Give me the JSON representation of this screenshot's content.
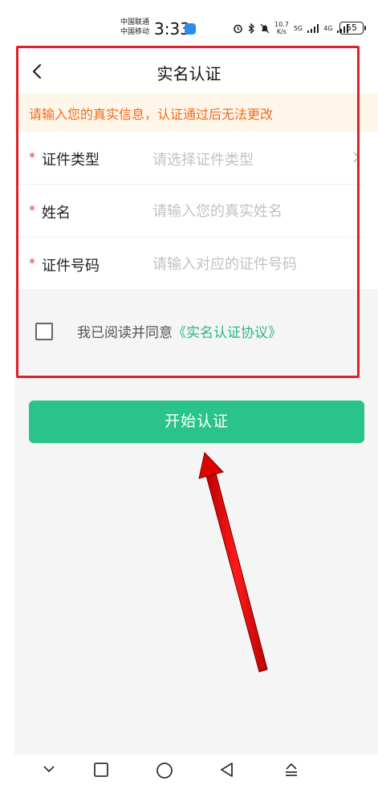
{
  "status_bar": {
    "carrier_1": "中国联通",
    "carrier_2": "中国移动",
    "time": "3:33",
    "speed_value": "10.7",
    "speed_unit": "K/s",
    "signal_5g": "5G",
    "signal_4g": "4G",
    "battery": "55"
  },
  "header": {
    "title": "实名认证"
  },
  "notice": {
    "text": "请输入您的真实信息，认证通过后无法更改"
  },
  "form": {
    "required_mark": "*",
    "id_type": {
      "label": "证件类型",
      "placeholder": "请选择证件类型"
    },
    "name": {
      "label": "姓名",
      "placeholder": "请输入您的真实姓名"
    },
    "id_number": {
      "label": "证件号码",
      "placeholder": "请输入对应的证件号码"
    }
  },
  "agreement": {
    "text": "我已阅读并同意",
    "link": "《实名认证协议》",
    "checked": false
  },
  "actions": {
    "start_label": "开始认证"
  },
  "colors": {
    "accent": "#2bc38c",
    "notice_text": "#f06a1c",
    "required": "#e23a3a",
    "highlight": "#e0202a"
  }
}
